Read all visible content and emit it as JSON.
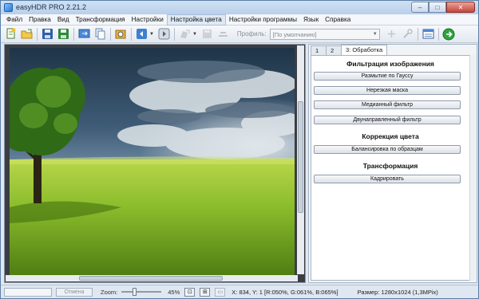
{
  "window": {
    "title": "easyHDR PRO 2.21.2"
  },
  "window_controls": {
    "minimize": "–",
    "maximize": "□",
    "close": "✕"
  },
  "menu": [
    "Файл",
    "Правка",
    "Вид",
    "Трансформация",
    "Настройки",
    "Настройка цвета",
    "Настройки программы",
    "Язык",
    "Справка"
  ],
  "toolbar": {
    "profiles_label": "Профиль:",
    "profile_value": "[По умолчанию]",
    "icons": [
      "open-new-icon",
      "open-folder-icon",
      "save-icon",
      "save-as-icon",
      "export-icon",
      "copy-icon",
      "batch-icon",
      "prev-icon",
      "next-icon",
      "process-icon",
      "save-profile-icon",
      "reset-icon",
      "add-profile-icon",
      "tools-icon",
      "settings-icon",
      "run-icon"
    ]
  },
  "panel": {
    "tabs": [
      "1",
      "2",
      "3: Обработка"
    ],
    "active_tab": 2,
    "sections": [
      {
        "title": "Фильтрация изображения",
        "buttons": [
          "Размытие по Гауссу",
          "Нерезкая маска",
          "Медианный фильтр",
          "Двунаправленный фильтр"
        ]
      },
      {
        "title": "Коррекция цвета",
        "buttons": [
          "Балансировка по образцам"
        ]
      },
      {
        "title": "Трансформация",
        "buttons": [
          "Кадрировать"
        ]
      }
    ]
  },
  "status": {
    "cancel_label": "Отмена",
    "zoom_label": "Zoom:",
    "zoom_value": "45%",
    "zoom_level": 0.45,
    "coords": "X: 834, Y: 1  [R:050%, G:061%, B:065%]",
    "size": "Размер: 1280x1024 (1,3MPix)"
  },
  "colors": {
    "accent": "#3a78c8",
    "titlebar": "#bfd3ea",
    "close": "#c6463a"
  }
}
